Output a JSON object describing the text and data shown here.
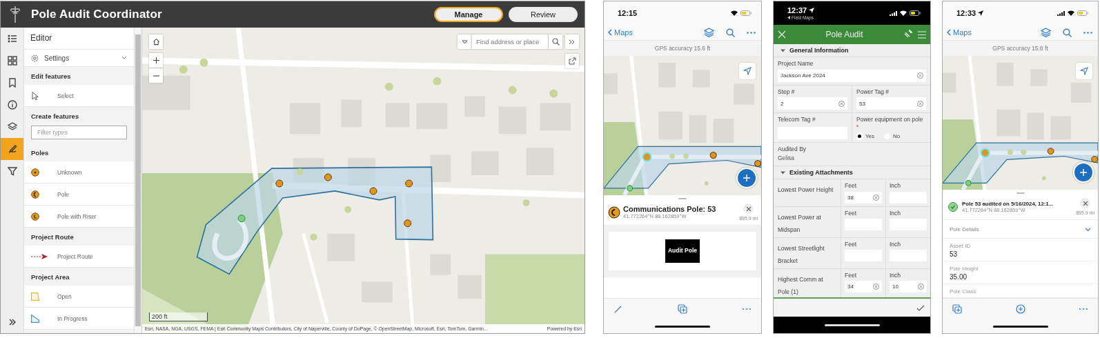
{
  "web_app": {
    "title": "Pole Audit Coordinator",
    "header_buttons": [
      {
        "label": "Manage",
        "selected": true
      },
      {
        "label": "Review",
        "selected": false
      }
    ],
    "rail": [
      {
        "kind": "list",
        "selected": false
      },
      {
        "kind": "widgets",
        "selected": false
      },
      {
        "kind": "bookmark",
        "selected": false
      },
      {
        "kind": "info",
        "selected": false
      },
      {
        "kind": "layers",
        "selected": false
      },
      {
        "kind": "edit",
        "selected": true
      },
      {
        "kind": "filter",
        "selected": false
      }
    ],
    "editor": {
      "title": "Editor",
      "settings": "Settings",
      "sections": [
        {
          "heading": "Edit features",
          "items": [
            {
              "kind": "select",
              "label": "Select"
            }
          ]
        },
        {
          "heading": "Create features",
          "filter_placeholder": "Filter types"
        },
        {
          "heading": "Poles",
          "items": [
            {
              "kind": "unknown",
              "label": "Unknown"
            },
            {
              "kind": "pole",
              "label": "Pole"
            },
            {
              "kind": "riser",
              "label": "Pole with Riser"
            }
          ]
        },
        {
          "heading": "Project Route",
          "items": [
            {
              "kind": "route",
              "label": "Project Route"
            }
          ]
        },
        {
          "heading": "Project Area",
          "items": [
            {
              "kind": "area-open",
              "label": "Open"
            },
            {
              "kind": "area-progress",
              "label": "In Progress"
            }
          ]
        }
      ]
    },
    "map": {
      "search_placeholder": "Find address or place",
      "scale": "200 ft",
      "attribution": "Esri, NASA, NGA, USGS, FEMA | Esri Community Maps Contributors, City of Naperville, County of DuPage, © OpenStreetMap, Microsoft, Esri, TomTom, Garmin...",
      "powered_by": "Powered by Esri"
    }
  },
  "phones": [
    {
      "kind": "map-card",
      "time": "12:15",
      "location_arrow": false,
      "cell_signal": false,
      "back": "Maps",
      "gps": "GPS accuracy 15.6 ft",
      "feature": {
        "kind": "pole",
        "title": "Communications Pole: 53",
        "coords": "41.772264°N 88.162859°W",
        "distance": "895.9 mi"
      },
      "action": "Audit Pole",
      "toolbar": [
        {
          "kind": "pencil"
        },
        {
          "kind": "add-copy"
        },
        {
          "kind": "more"
        }
      ]
    },
    {
      "kind": "form",
      "time": "12:37",
      "location_arrow": true,
      "cell_signal": true,
      "back_app": "Field Maps",
      "title": "Pole Audit",
      "general": {
        "heading": "General Information",
        "expanded": true,
        "project_name": {
          "label": "Project Name",
          "value": "Jackson Ave 2024"
        },
        "step": {
          "label": "Step #",
          "value": "2"
        },
        "power_tag": {
          "label": "Power Tag #",
          "value": "53"
        },
        "telecom_tag": {
          "label": "Telecom Tag #"
        },
        "power_equipment": {
          "label": "Power equipment on pole",
          "required_mark": "*",
          "options": [
            {
              "label": "Yes",
              "selected": true
            },
            {
              "label": "No",
              "selected": false
            }
          ]
        },
        "audited_by": {
          "label": "Audited By",
          "value": "Gelisa"
        }
      },
      "attachments": {
        "heading": "Existing Attachments",
        "expanded": true,
        "rows": [
          {
            "label": "Lowest Power Height",
            "feet_label": "Feet",
            "feet": "38",
            "inch_label": "Inch"
          },
          {
            "label": "Lowest Power at Midspan",
            "feet_label": "Feet",
            "inch_label": "Inch"
          },
          {
            "label": "Lowest Streetlight Bracket",
            "feet_label": "Feet",
            "inch_label": "Inch"
          },
          {
            "label": "Highest Comm at Pole (1)",
            "feet_label": "Feet",
            "feet": "34",
            "inch_label": "Inch",
            "inch": "10"
          }
        ]
      }
    },
    {
      "kind": "map-card",
      "time": "12:33",
      "location_arrow": true,
      "cell_signal": true,
      "back": "Maps",
      "gps": "GPS accuracy 15.8 ft",
      "feature": {
        "kind": "audited",
        "title": "Pole 53 audited on 5/16/2024, 12:1...",
        "coords": "41.772264°N 88.162859°W",
        "distance": "895.9 mi"
      },
      "details": {
        "heading": "Pole Details",
        "expanded": true,
        "fields": [
          {
            "label": "Asset ID",
            "value": "53"
          },
          {
            "label": "Pole Height",
            "value": "35.00"
          },
          {
            "label": "Pole Class"
          }
        ]
      },
      "toolbar": [
        {
          "kind": "add-copy"
        },
        {
          "kind": "add-circle"
        },
        {
          "kind": "more"
        }
      ]
    }
  ]
}
